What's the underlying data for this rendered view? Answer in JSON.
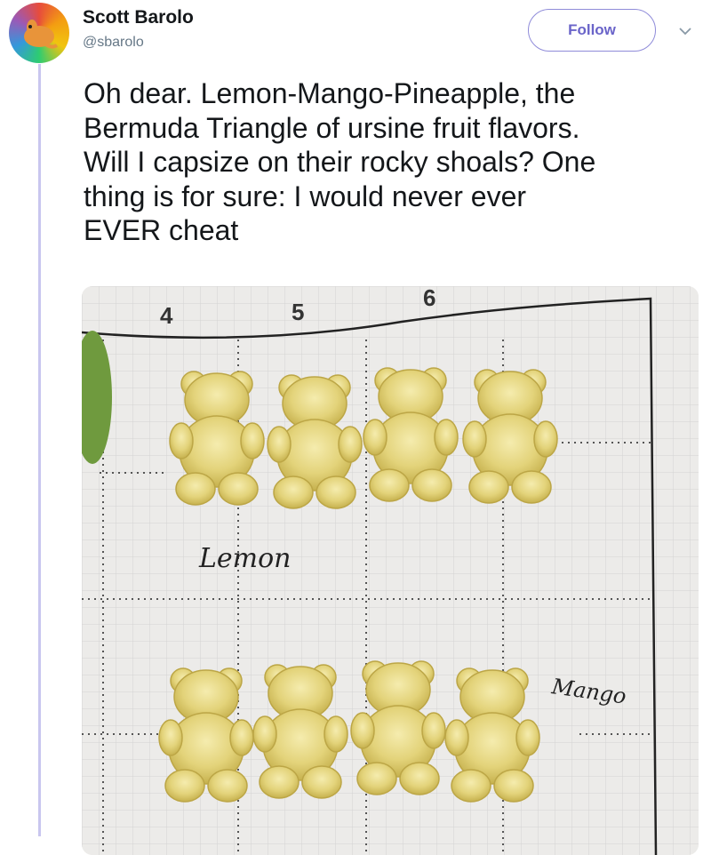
{
  "tweet": {
    "author_name": "Scott Barolo",
    "author_handle": "@sbarolo",
    "follow_label": "Follow",
    "text_lines": [
      "Oh dear. Lemon-Mango-Pineapple, the",
      "Bermuda Triangle of ursine fruit flavors.",
      "Will I capsize on their rocky shoals? One",
      "thing is for sure: I would never ever",
      "EVER cheat"
    ]
  },
  "photo": {
    "column_numbers": [
      "4",
      "5",
      "6"
    ],
    "handwritten_labels": [
      "Lemon",
      "Mango"
    ]
  },
  "icons": {
    "avatar": "avatar-icon",
    "caret": "chevron-down-icon"
  },
  "colors": {
    "follow_accent": "#6a64c9",
    "thread_line": "#c9c6ef",
    "handle": "#657786",
    "text": "#14171a",
    "gummy": "#e3d37a"
  }
}
